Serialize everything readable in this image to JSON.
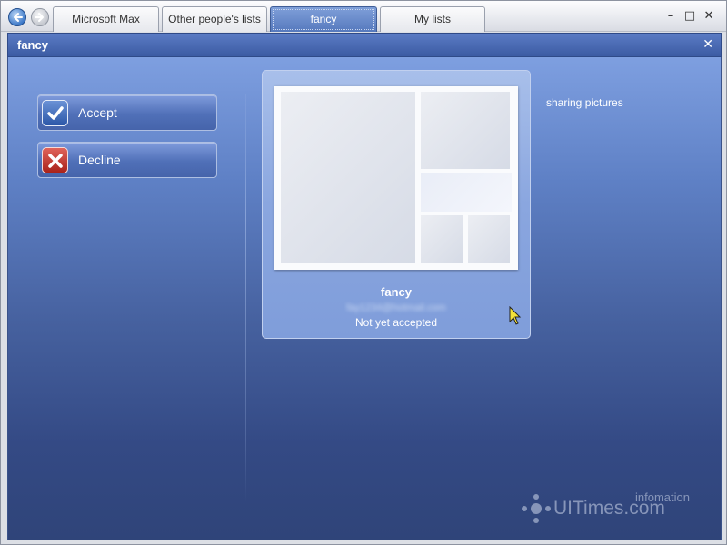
{
  "tabs": [
    {
      "label": "Microsoft Max"
    },
    {
      "label": "Other people's lists"
    },
    {
      "label": "fancy"
    },
    {
      "label": "My lists"
    }
  ],
  "window_controls": {
    "minimize": "–",
    "maximize": "□",
    "close": "✕"
  },
  "titlebar": {
    "title": "fancy",
    "close": "✕"
  },
  "actions": {
    "accept_label": "Accept",
    "decline_label": "Decline"
  },
  "card": {
    "name": "fancy",
    "email": "fay1234@hotmail.com",
    "status": "Not yet accepted"
  },
  "side_note": "sharing pictures",
  "watermark": {
    "main": "UITimes.com",
    "sub": "infomation"
  }
}
